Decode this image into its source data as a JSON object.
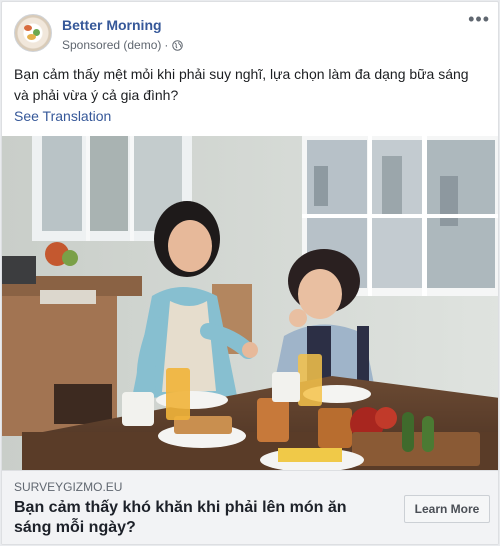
{
  "post": {
    "page_name": "Better Morning",
    "sponsored_label": "Sponsored (demo)",
    "separator": "·",
    "more_glyph": "•••",
    "text": "Bạn cảm thấy mệt mỏi khi phải suy nghĩ, lựa chọn làm đa dạng bữa sáng và phải vừa ý cả gia đình?",
    "see_translation": "See Translation"
  },
  "link_preview": {
    "domain": "SURVEYGIZMO.EU",
    "headline": "Bạn cảm thấy khó khăn khi phải lên món ăn sáng mỗi ngày?",
    "cta_label": "Learn More"
  },
  "colors": {
    "link_blue": "#365899",
    "footer_bg": "#f2f3f5",
    "page_bg": "#e9ebee"
  },
  "icons": {
    "privacy": "globe-icon",
    "menu": "more-options-icon"
  }
}
